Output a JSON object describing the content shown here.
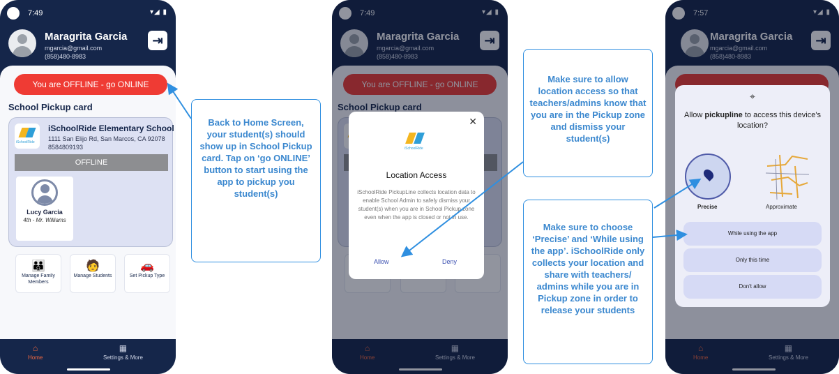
{
  "status": {
    "time_1": "7:49",
    "time_2": "7:49",
    "time_3": "7:57",
    "signal": "▾◢ ▮"
  },
  "user": {
    "name": "Maragrita Garcia",
    "email": "mgarcia@gmail.com",
    "phone": "(858)480-8983"
  },
  "home": {
    "online_button": "You are OFFLINE - go ONLINE",
    "section_title": "School Pickup card",
    "school": {
      "name": "iSchoolRide Elementary School",
      "address": "1111 San Elijo Rd, San Marcos, CA 92078",
      "phone": "8584809193",
      "logo_text": "iSchoolRide"
    },
    "offline_label": "OFFLINE",
    "student": {
      "name": "Lucy Garcia",
      "grade": "4th - Mr. Williams"
    },
    "actions": [
      {
        "label": "Manage Family Members",
        "icon": "family-icon"
      },
      {
        "label": "Manage Students",
        "icon": "students-icon"
      },
      {
        "label": "Set Pickup Type",
        "icon": "car-icon"
      }
    ]
  },
  "nav": {
    "home": "Home",
    "settings": "Settings & More"
  },
  "dialog": {
    "title": "Location Access",
    "body": "iSchoolRide PickupLine collects location data to enable School Admin to safely dismiss your student(s) when you are in School Pickup zone even when the app is closed or not in use.",
    "allow": "Allow",
    "deny": "Deny"
  },
  "permission": {
    "question_prefix": "Allow ",
    "app_name": "pickupline",
    "question_suffix": " to access this device's location?",
    "precise": "Precise",
    "approximate": "Approximate",
    "options": [
      "While using the app",
      "Only this time",
      "Don't allow"
    ]
  },
  "callouts": [
    "Back to Home Screen, your student(s) should show up in School Pickup card. Tap on ‘go ONLINE’ button to start using the app to pickup you student(s)",
    "Make sure to allow location access so that teachers/admins know that you are in the Pickup zone and dismiss your student(s)",
    "Make sure to choose ‘Precise’ and ‘While using the app’. iSchoolRide only collects your location and share with teachers/ admins while you are in Pickup zone in order to release your students"
  ],
  "colors": {
    "navy": "#15264a",
    "red": "#ef3b34",
    "callout_blue": "#2f8fe0",
    "nav_active": "#f2683f"
  }
}
